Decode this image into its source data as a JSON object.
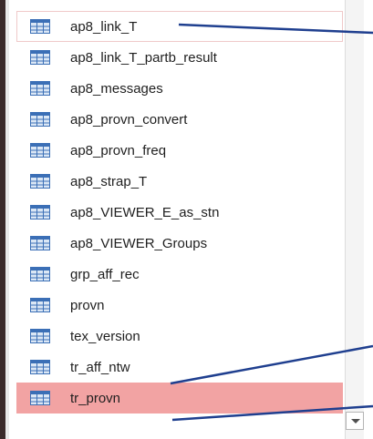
{
  "table_list": {
    "items": [
      {
        "label": "ap8_link_T",
        "state": "focused"
      },
      {
        "label": "ap8_link_T_partb_result",
        "state": "normal"
      },
      {
        "label": "ap8_messages",
        "state": "normal"
      },
      {
        "label": "ap8_provn_convert",
        "state": "normal"
      },
      {
        "label": "ap8_provn_freq",
        "state": "normal"
      },
      {
        "label": "ap8_strap_T",
        "state": "normal"
      },
      {
        "label": "ap8_VIEWER_E_as_stn",
        "state": "normal"
      },
      {
        "label": "ap8_VIEWER_Groups",
        "state": "normal"
      },
      {
        "label": "grp_aff_rec",
        "state": "normal"
      },
      {
        "label": "provn",
        "state": "normal"
      },
      {
        "label": "tex_version",
        "state": "normal"
      },
      {
        "label": "tr_aff_ntw",
        "state": "normal"
      },
      {
        "label": "tr_provn",
        "state": "selected"
      }
    ],
    "icon": "table-icon"
  },
  "colors": {
    "selected_background": "#f2a3a3",
    "focus_border": "#f0c9c9",
    "annotation_arrow": "#1f3f8f",
    "icon_header": "#3b6fb6",
    "icon_cell": "#dbe7f5"
  },
  "scrollbar": {
    "icon": "chevron-down-icon"
  }
}
